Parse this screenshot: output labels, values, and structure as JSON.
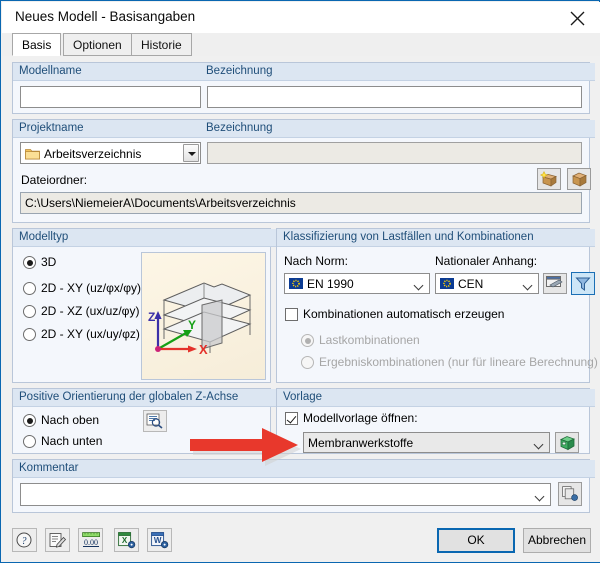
{
  "window": {
    "title": "Neues Modell - Basisangaben",
    "close_icon": "close-icon"
  },
  "tabs": [
    {
      "label": "Basis",
      "active": true
    },
    {
      "label": "Optionen",
      "active": false
    },
    {
      "label": "Historie",
      "active": false
    }
  ],
  "model_group": {
    "header_name": "Modellname",
    "header_desc": "Bezeichnung",
    "name_value": "",
    "desc_value": ""
  },
  "project_group": {
    "header_name": "Projektname",
    "header_desc": "Bezeichnung",
    "combo_value": "Arbeitsverzeichnis",
    "combo_icon": "folder-icon",
    "desc_value": "",
    "new_project_icon": "new-project-box-icon",
    "open_project_icon": "open-project-box-icon",
    "folder_label": "Dateiordner:",
    "folder_path": "C:\\Users\\NiemeierA\\Documents\\Arbeitsverzeichnis"
  },
  "modeltype": {
    "header": "Modelltyp",
    "options": [
      {
        "label": "3D",
        "selected": true,
        "accel": ""
      },
      {
        "label": "2D - XY (uz/φx/φy)",
        "selected": false
      },
      {
        "label": "2D - XZ (ux/uz/φy)",
        "selected": false
      },
      {
        "label": "2D - XY (ux/uy/φz)",
        "selected": false
      }
    ],
    "preview_axes": [
      "Z",
      "Y",
      "X"
    ],
    "preview_icon": "building-3d-preview"
  },
  "classification": {
    "header": "Klassifizierung von Lastfällen und Kombinationen",
    "standard_label": "Nach Norm:",
    "standard_value": "EN 1990",
    "annex_label": "Nationaler Anhang:",
    "annex_value": "CEN",
    "flag_icon": "eu-flag-icon",
    "settings_icon": "settings-window-icon",
    "filter_icon": "filter-funnel-icon",
    "auto_checkbox": {
      "label": "Kombinationen automatisch erzeugen",
      "checked": false
    },
    "sub_options": [
      {
        "label": "Lastkombinationen",
        "selected": true,
        "disabled": true
      },
      {
        "label": "Ergebniskombinationen (nur für lineare Berechnung)",
        "selected": false,
        "disabled": true
      }
    ]
  },
  "orientation": {
    "header": "Positive Orientierung der globalen Z-Achse",
    "options": [
      {
        "label": "Nach oben",
        "selected": true
      },
      {
        "label": "Nach unten",
        "selected": false
      }
    ],
    "info_icon": "preview-magnifier-icon"
  },
  "template": {
    "header": "Vorlage",
    "checkbox": {
      "label": "Modellvorlage öffnen:",
      "checked": true
    },
    "combo_value": "Membranwerkstoffe",
    "open_icon": "green-box-open-icon"
  },
  "comment": {
    "header": "Kommentar",
    "value": "",
    "copy_icon": "copy-pages-icon"
  },
  "toolbar": [
    {
      "icon": "help-question-icon",
      "name": "help-button"
    },
    {
      "icon": "edit-pencil-icon",
      "name": "edit-button"
    },
    {
      "icon": "units-ruler-icon",
      "name": "units-button",
      "text": "0.00"
    },
    {
      "icon": "excel-export-icon",
      "name": "excel-button"
    },
    {
      "icon": "word-export-icon",
      "name": "word-button"
    }
  ],
  "footer": {
    "ok_label": "OK",
    "cancel_label": "Abbrechen"
  },
  "annotation": {
    "arrow_icon": "red-arrow-annotation",
    "color": "#e8382c"
  },
  "colors": {
    "window_border": "#0a67b1",
    "group_header_bg": "#dce6f2",
    "group_header_text": "#1f4e79",
    "accent": "#0a67b1"
  }
}
